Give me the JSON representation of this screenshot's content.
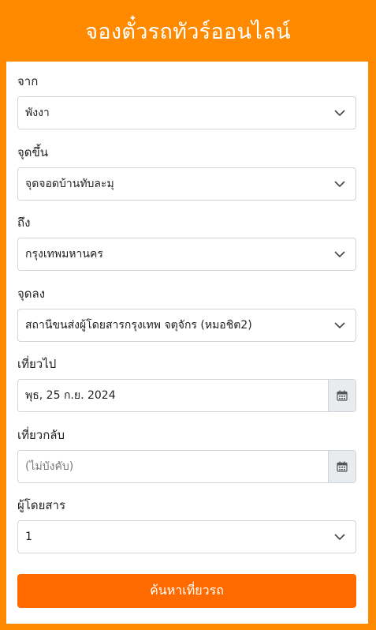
{
  "header": {
    "title": "จองตั๋วรถทัวร์ออนไลน์"
  },
  "form": {
    "from": {
      "label": "จาก",
      "value": "พังงา"
    },
    "pickup": {
      "label": "จุดขึ้น",
      "value": "จุดจอดบ้านทับละมุ"
    },
    "to": {
      "label": "ถึง",
      "value": "กรุงเทพมหานคร"
    },
    "dropoff": {
      "label": "จุดลง",
      "value": "สถานีขนส่งผู้โดยสารกรุงเทพ จตุจักร (หมอชิต2)"
    },
    "depart": {
      "label": "เที่ยวไป",
      "value": "พุธ, 25 ก.ย. 2024"
    },
    "return": {
      "label": "เที่ยวกลับ",
      "placeholder": "(ไม่บังคับ)"
    },
    "passengers": {
      "label": "ผู้โดยสาร",
      "value": "1"
    }
  },
  "search_button": {
    "label": "ค้นหาเที่ยวรถ"
  },
  "colors": {
    "brand": "#ff8a00",
    "button": "#ff6a00"
  },
  "icons": {
    "select": "chevron-down-icon",
    "date": "calendar-icon"
  }
}
